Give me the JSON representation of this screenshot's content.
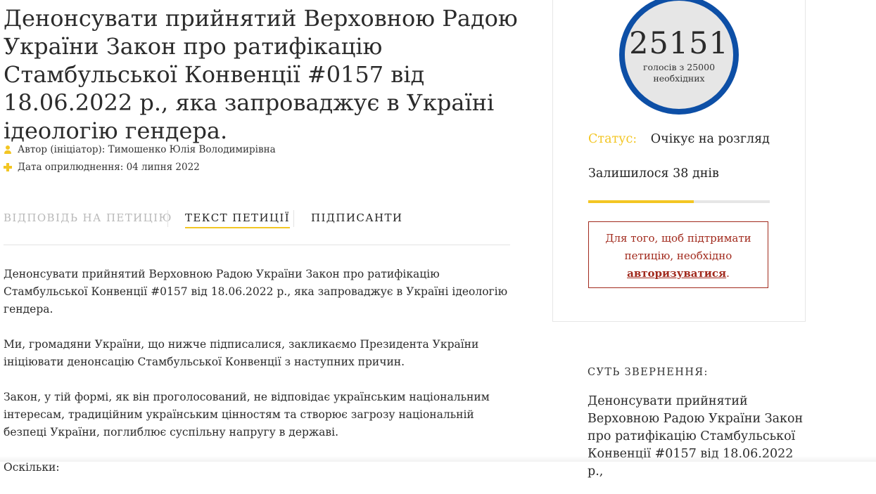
{
  "petition": {
    "title": "Денонсувати прийнятий Верховною Радою України Закон про ратифікацію Стамбульської Конвенції #0157 від 18.06.2022 р., яка запроваджує в Україні ідеологію гендера.",
    "author": "Автор (ініціатор): Тимошенко Юлія Володимирівна",
    "date": "Дата оприлюднення: 04 липня 2022"
  },
  "tabs": [
    {
      "label": "ВІДПОВІДЬ НА ПЕТИЦІЮ",
      "state": "disabled"
    },
    {
      "label": "ТЕКСТ ПЕТИЦІЇ",
      "state": "active"
    },
    {
      "label": "ПІДПИСАНТИ",
      "state": "normal"
    }
  ],
  "body": {
    "paragraphs": [
      "Денонсувати прийнятий Верховною Радою України Закон про ратифікацію Стамбульської Конвенції #0157 від 18.06.2022 р., яка запроваджує в Україні ідеологію гендера.",
      "Ми, громадяни України, що нижче підписалися, закликаємо Президента України ініціювати денонсацію Стамбульської Конвенції з наступних причин.",
      "Закон, у тій формі, як він проголосований, не відповідає українським національним інтересам, традиційним українським цінностям та створює загрозу національній безпеці України, поглиблює суспільну напругу в державі.",
      "Оскільки:"
    ]
  },
  "sidebar": {
    "vote_count": "25151",
    "vote_caption": "голосів з 25000 необхідних",
    "status_label": "Статус:",
    "status_value": "Очікує на розгляд",
    "remaining": "Залишилося 38 днів",
    "progress_fraction": 0.58,
    "auth_text_before": "Для того, щоб підтримати петицію, необхідно",
    "auth_link": "авторизуватися",
    "auth_text_after": ".",
    "summary_heading": "СУТЬ ЗВЕРНЕННЯ:",
    "summary_text": "Денонсувати прийнятий Верховною Радою України Закон про ратифікацію Стамбульської Конвенції #0157 від 18.06.2022 р.,"
  },
  "colors": {
    "accent_yellow": "#f3c623",
    "circle_blue": "#0d4fa6",
    "auth_red": "#a12a1d"
  },
  "icons": [
    "person-icon",
    "plus-icon"
  ]
}
